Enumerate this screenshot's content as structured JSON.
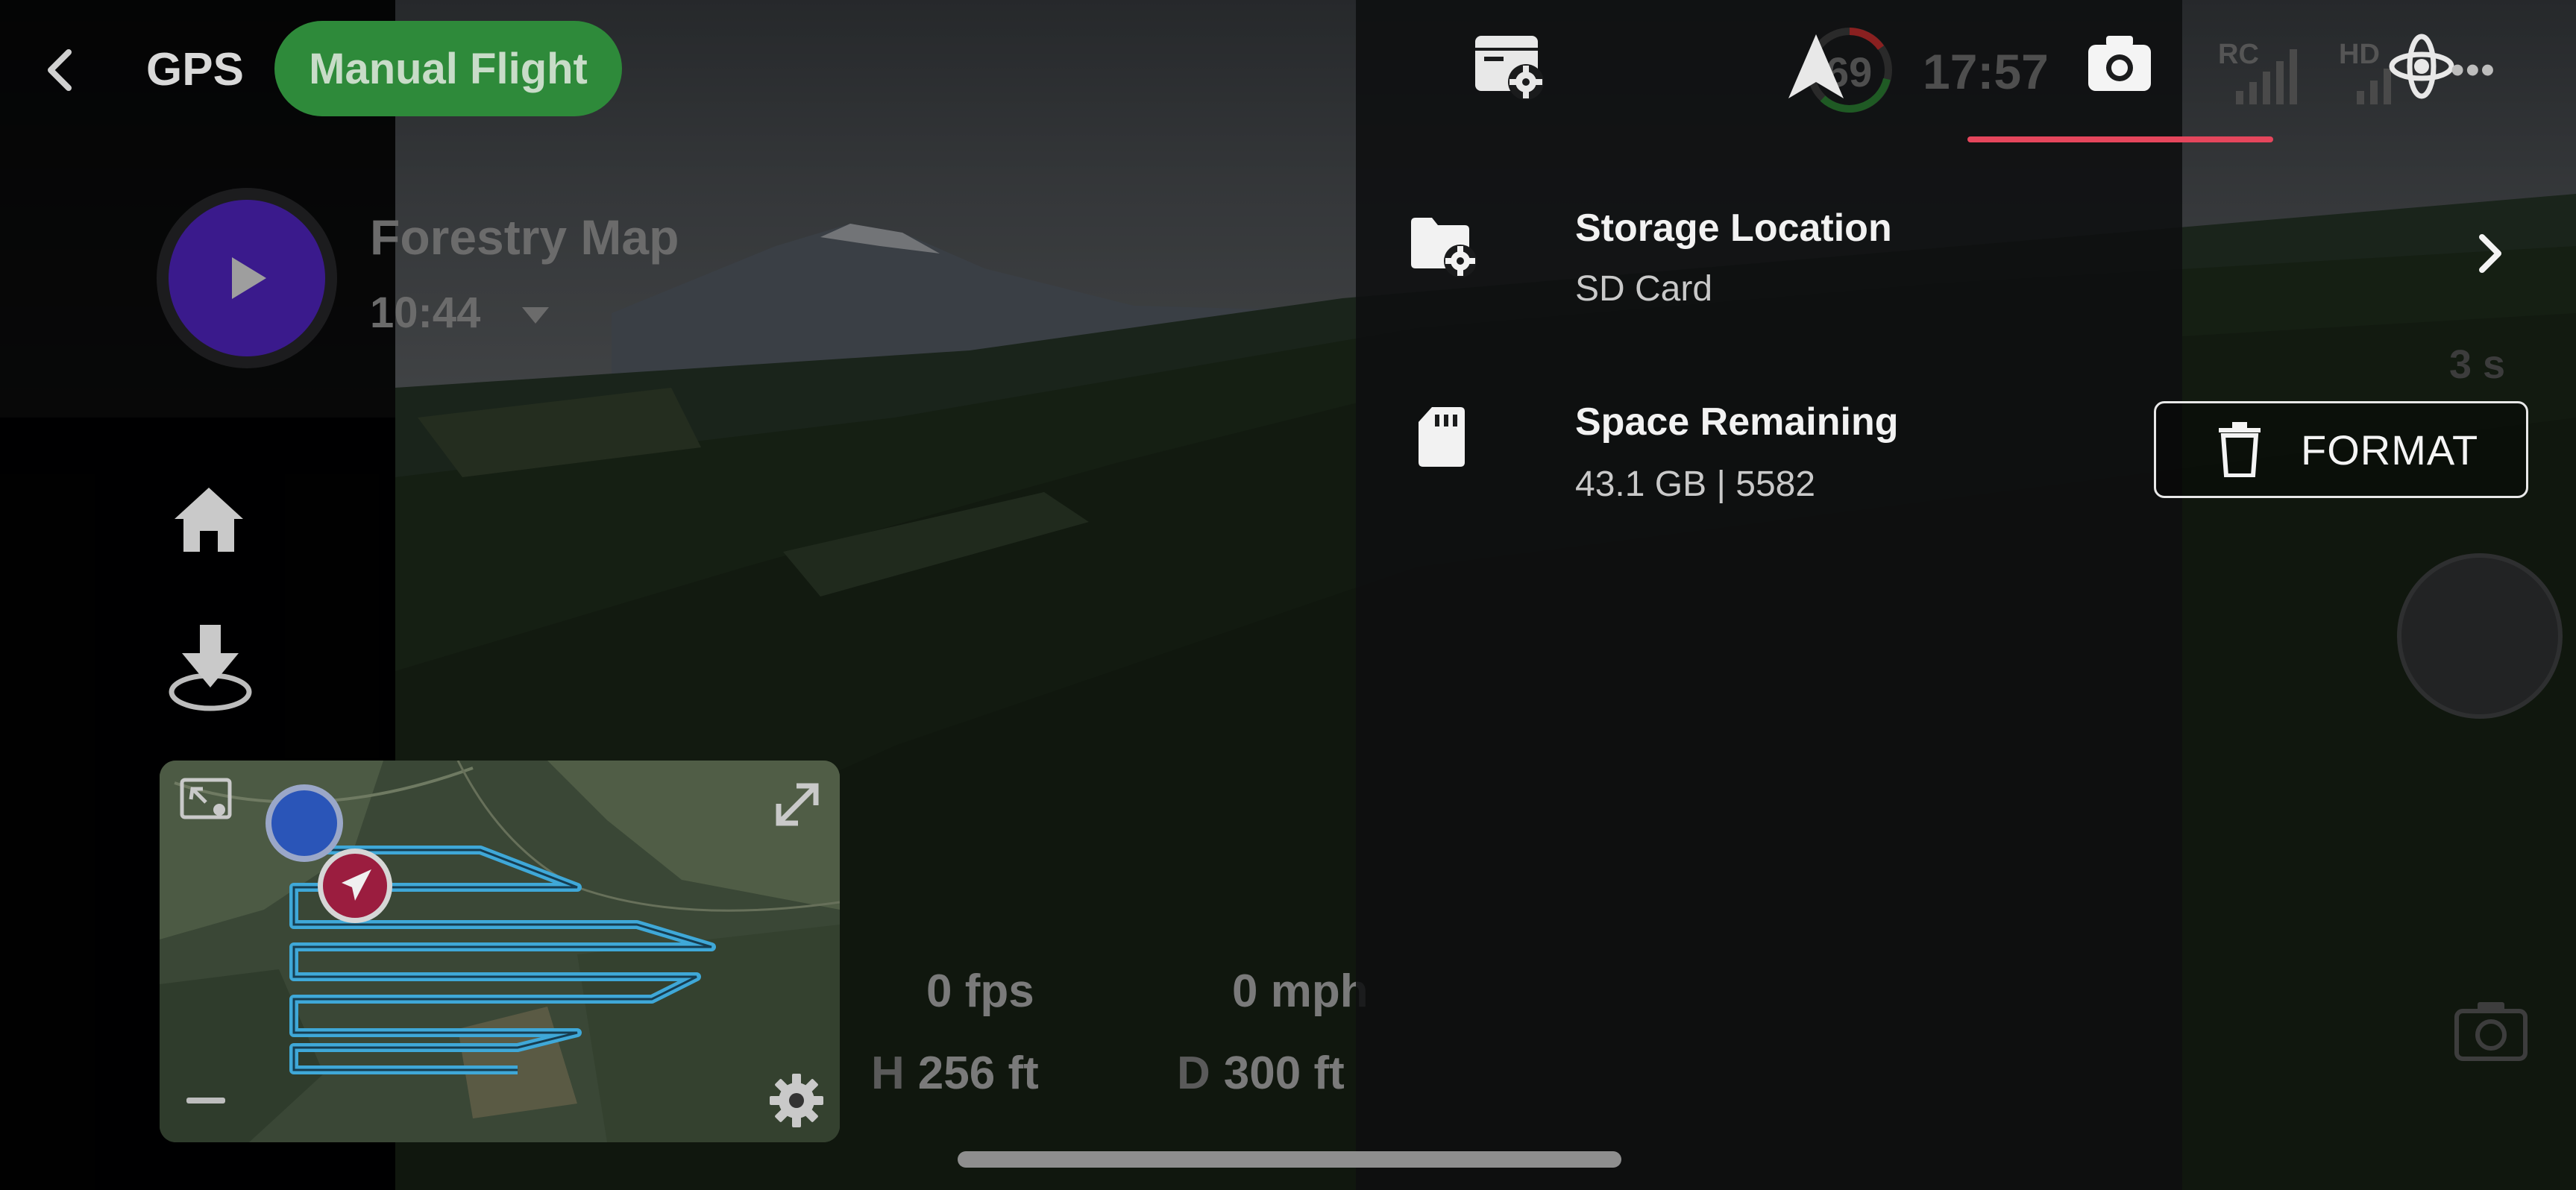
{
  "top_bar": {
    "gps_label": "GPS",
    "flight_mode": "Manual Flight",
    "battery_level": "69",
    "flight_time": "17:57",
    "rc_label": "RC",
    "hd_label": "HD",
    "more_label": "•••"
  },
  "mission": {
    "name": "Forestry Map",
    "time": "10:44"
  },
  "telemetry": {
    "vertical_speed": "0 fps",
    "horizontal_speed": "0 mph",
    "height_prefix": "H",
    "height": "256 ft",
    "distance_prefix": "D",
    "distance": "300 ft"
  },
  "settings_panel": {
    "storage_location_title": "Storage Location",
    "storage_location_value": "SD Card",
    "space_remaining_title": "Space Remaining",
    "space_remaining_value": "43.1 GB | 5582",
    "format_label": "FORMAT"
  },
  "camera": {
    "interval_label": "3 s"
  },
  "colors": {
    "flight_mode_pill": "#2e8a3a",
    "play_button": "#3a1a8c",
    "active_tab_underline": "#e5465c",
    "route_line": "#3fa8d8",
    "drone_marker": "#9b1d3f",
    "home_marker": "#2a55b8"
  },
  "icons": [
    "back-chevron-icon",
    "play-icon",
    "home-icon",
    "land-icon",
    "map-swap-icon",
    "expand-icon",
    "gear-icon",
    "sd-settings-icon",
    "navigation-arrow-icon",
    "camera-icon",
    "signal-bars-icon",
    "drone-icon",
    "more-icon",
    "folder-settings-icon",
    "sd-card-icon",
    "chevron-right-icon",
    "trash-icon"
  ]
}
